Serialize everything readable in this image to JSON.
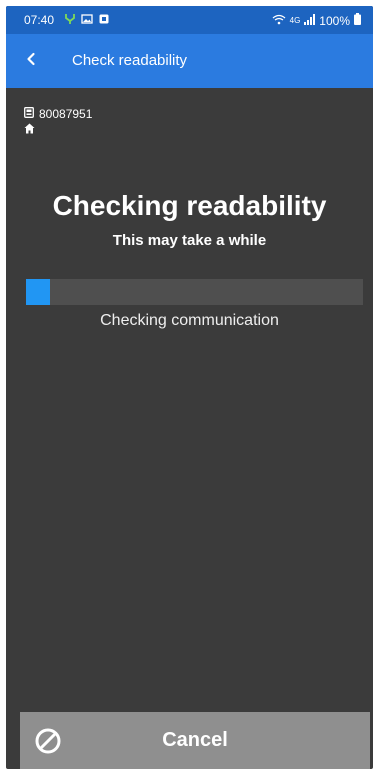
{
  "status_bar": {
    "time": "07:40",
    "battery": "100%",
    "network": "4G",
    "left_icons": [
      "fork-icon",
      "image-icon",
      "app-icon"
    ],
    "right_icons": [
      "wifi-icon",
      "signal-icon",
      "battery-icon"
    ]
  },
  "app_bar": {
    "title": "Check readability",
    "back_icon": "chevron-left-icon"
  },
  "device": {
    "id": "80087951",
    "id_icon": "device-icon",
    "location_icon": "home-icon"
  },
  "main": {
    "heading": "Checking readability",
    "subheading": "This may take a while",
    "progress_label": "Checking communication",
    "progress_fraction": 0.07
  },
  "footer": {
    "cancel_label": "Cancel",
    "cancel_icon": "block-icon"
  },
  "colors": {
    "status_bar": "#1d64c0",
    "app_bar": "#2b7be0",
    "background": "#3b3b3b",
    "progress_fill": "#2196f3",
    "progress_track": "#4f4f4f",
    "cancel_button": "#8f8f8f",
    "fork_icon": "#7ed957"
  }
}
